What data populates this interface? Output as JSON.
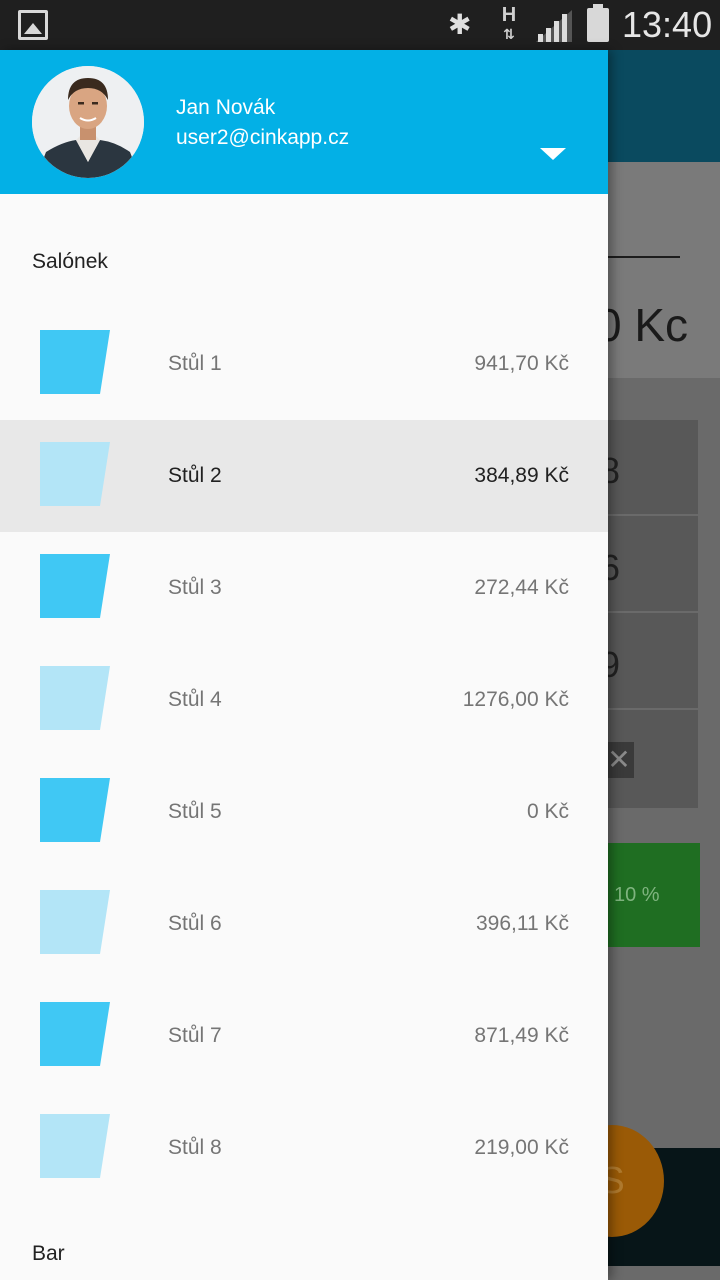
{
  "status_bar": {
    "time": "13:40",
    "network_label": "H"
  },
  "background_app": {
    "amount_fragment": "0 Kc",
    "rows": [
      "8",
      "6",
      "9"
    ],
    "discount_label": "10 %",
    "fab_label": "S"
  },
  "drawer": {
    "user": {
      "name": "Jan Novák",
      "email": "user2@cinkapp.cz"
    },
    "sections": [
      {
        "title": "Salónek"
      },
      {
        "title": "Bar"
      }
    ],
    "tables": [
      {
        "label": "Stůl 1",
        "amount": "941,70 Kč",
        "occupied": true,
        "selected": false
      },
      {
        "label": "Stůl 2",
        "amount": "384,89 Kč",
        "occupied": false,
        "selected": true
      },
      {
        "label": "Stůl 3",
        "amount": "272,44 Kč",
        "occupied": true,
        "selected": false
      },
      {
        "label": "Stůl 4",
        "amount": "1276,00 Kč",
        "occupied": false,
        "selected": false
      },
      {
        "label": "Stůl 5",
        "amount": "0 Kč",
        "occupied": true,
        "selected": false
      },
      {
        "label": "Stůl 6",
        "amount": "396,11 Kč",
        "occupied": false,
        "selected": false
      },
      {
        "label": "Stůl 7",
        "amount": "871,49 Kč",
        "occupied": true,
        "selected": false
      },
      {
        "label": "Stůl 8",
        "amount": "219,00 Kč",
        "occupied": false,
        "selected": false
      }
    ],
    "colors": {
      "header": "#03b0e6",
      "table_occupied": "#40c8f4",
      "table_free": "#b3e5f7",
      "selected_row": "#e8e8e8"
    }
  }
}
